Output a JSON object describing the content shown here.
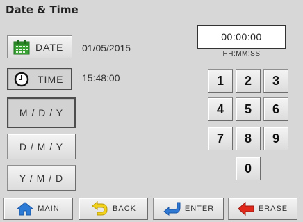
{
  "header": {
    "title": "Date & Time"
  },
  "left_buttons": {
    "date": {
      "label": "DATE",
      "icon": "calendar-icon"
    },
    "time": {
      "label": "TIME",
      "icon": "clock-icon"
    },
    "mdy": "M / D / Y",
    "dmy": "D / M / Y",
    "ymd": "Y / M / D"
  },
  "values": {
    "date": "01/05/2015",
    "time": "15:48:00"
  },
  "entry": {
    "display": "00:00:00",
    "format": "HH:MM:SS"
  },
  "keypad": {
    "k1": "1",
    "k2": "2",
    "k3": "3",
    "k4": "4",
    "k5": "5",
    "k6": "6",
    "k7": "7",
    "k8": "8",
    "k9": "9",
    "k0": "0"
  },
  "bottom_bar": {
    "main": {
      "label": "MAIN",
      "icon": "home-icon"
    },
    "back": {
      "label": "BACK",
      "icon": "back-arrow-icon"
    },
    "enter": {
      "label": "ENTER",
      "icon": "enter-arrow-icon"
    },
    "erase": {
      "label": "ERASE",
      "icon": "erase-arrow-icon"
    }
  },
  "colors": {
    "background": "#d7d7d7",
    "calendar_green": "#3aa234",
    "home_blue": "#2b7bd6",
    "back_yellow": "#f2d21b",
    "enter_blue": "#2f78d4",
    "erase_red": "#e0281b"
  }
}
